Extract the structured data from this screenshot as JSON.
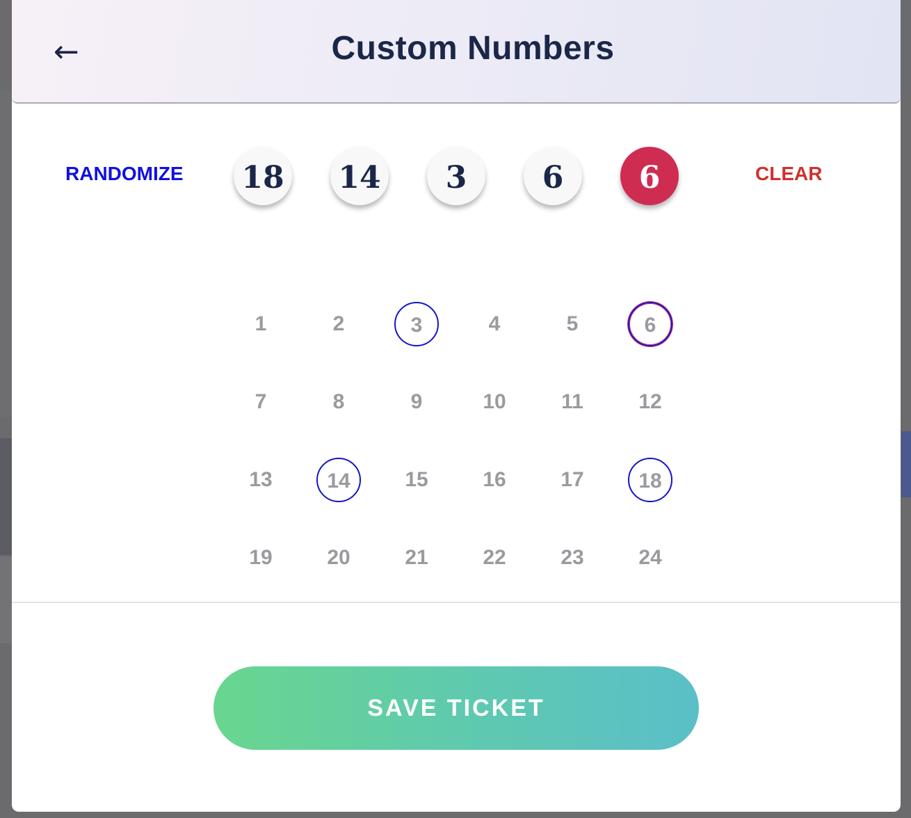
{
  "header": {
    "back_icon": "←",
    "title": "Custom Numbers"
  },
  "controls": {
    "randomize_label": "RANDOMIZE",
    "clear_label": "CLEAR"
  },
  "selected_balls": [
    "18",
    "14",
    "3",
    "6"
  ],
  "bonus_ball": "6",
  "grid": {
    "numbers": [
      "1",
      "2",
      "3",
      "4",
      "5",
      "6",
      "7",
      "8",
      "9",
      "10",
      "11",
      "12",
      "13",
      "14",
      "15",
      "16",
      "17",
      "18",
      "19",
      "20",
      "21",
      "22",
      "23",
      "24"
    ],
    "selected": [
      "3",
      "14",
      "18"
    ],
    "bonus_selected": [
      "6"
    ]
  },
  "save_button_label": "SAVE TICKET",
  "colors": {
    "title": "#1b2748",
    "randomize": "#1010e0",
    "clear": "#d0312d",
    "bonus_ball": "#cf2c52",
    "button_gradient_start": "#69d68f",
    "button_gradient_end": "#5bbfc8"
  }
}
